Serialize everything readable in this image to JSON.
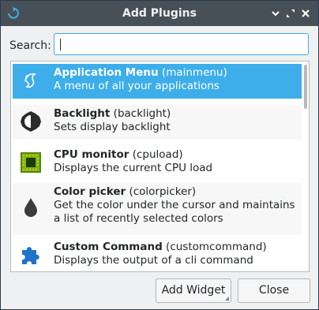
{
  "window": {
    "title": "Add Plugins",
    "buttons": [
      "shade-icon",
      "maximize-icon",
      "close-icon"
    ]
  },
  "search": {
    "label": "Search:",
    "value": "",
    "placeholder": ""
  },
  "plugins": [
    {
      "name": "Application Menu",
      "id": "(mainmenu)",
      "description": "A menu of all your applications",
      "icon": "mainmenu-icon",
      "selected": true
    },
    {
      "name": "Backlight",
      "id": "(backlight)",
      "description": "Sets display backlight",
      "icon": "backlight-icon"
    },
    {
      "name": "CPU monitor",
      "id": "(cpuload)",
      "description": "Displays the current CPU load",
      "icon": "cpu-icon"
    },
    {
      "name": "Color picker",
      "id": "(colorpicker)",
      "description": "Get the color under the cursor and maintains a list of recently selected colors",
      "icon": "color-picker-icon"
    },
    {
      "name": "Custom Command",
      "id": "(customcommand)",
      "description": "Displays the output of a cli command",
      "icon": "puzzle-icon"
    }
  ],
  "footer": {
    "add_label": "Add Widget",
    "close_label": "Close"
  },
  "colors": {
    "accent": "#3daee9",
    "titlebar": "#475057",
    "window_bg": "#eff0f1"
  }
}
